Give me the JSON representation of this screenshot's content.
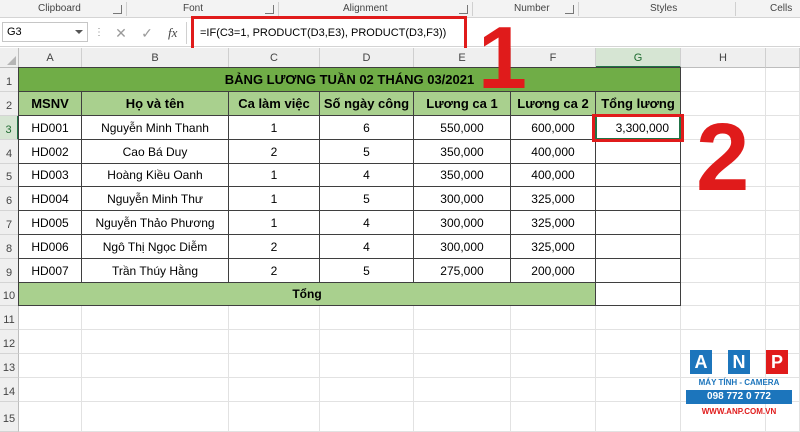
{
  "ribbon": {
    "groups": [
      "Clipboard",
      "Font",
      "Alignment",
      "Number",
      "Styles",
      "Cells"
    ]
  },
  "formula_bar": {
    "name_box": "G3",
    "formula": "=IF(C3=1, PRODUCT(D3,E3), PRODUCT(D3,F3))",
    "cancel_icon": "close-icon",
    "enter_icon": "check-icon",
    "fx_label": "fx"
  },
  "columns": [
    "A",
    "B",
    "C",
    "D",
    "E",
    "F",
    "G",
    "H"
  ],
  "rows": [
    "1",
    "2",
    "3",
    "4",
    "5",
    "6",
    "7",
    "8",
    "9",
    "10",
    "11",
    "12",
    "13",
    "14",
    "15"
  ],
  "table": {
    "title": "BẢNG LƯƠNG TUẦN 02 THÁNG 03/2021",
    "headers": [
      "MSNV",
      "Họ và tên",
      "Ca làm việc",
      "Số ngày công",
      "Lương ca 1",
      "Lương ca 2",
      "Tổng lương"
    ],
    "rows": [
      [
        "HD001",
        "Nguyễn Minh Thanh",
        "1",
        "6",
        "550,000",
        "600,000",
        "3,300,000"
      ],
      [
        "HD002",
        "Cao Bá Duy",
        "2",
        "5",
        "350,000",
        "400,000",
        ""
      ],
      [
        "HD003",
        "Hoàng Kiều Oanh",
        "1",
        "4",
        "350,000",
        "400,000",
        ""
      ],
      [
        "HD004",
        "Nguyễn Minh Thư",
        "1",
        "5",
        "300,000",
        "325,000",
        ""
      ],
      [
        "HD005",
        "Nguyễn Thảo Phương",
        "1",
        "4",
        "300,000",
        "325,000",
        ""
      ],
      [
        "HD006",
        "Ngô Thị Ngọc Diễm",
        "2",
        "4",
        "300,000",
        "325,000",
        ""
      ],
      [
        "HD007",
        "Trần Thúy Hằng",
        "2",
        "5",
        "275,000",
        "200,000",
        ""
      ]
    ],
    "total_label": "Tổng"
  },
  "annotations": {
    "step1": "1",
    "step2": "2"
  },
  "logo": {
    "letters": [
      "A",
      "N",
      "P"
    ],
    "tagline": "MÁY TÍNH - CAMERA",
    "phone": "098 772 0 772",
    "website": "WWW.ANP.COM.VN"
  },
  "colors": {
    "title_fill": "#70ad47",
    "header_fill": "#a9d08e",
    "callout_red": "#e01b1b",
    "selection_green": "#217346",
    "logo_blue": "#1c75bc",
    "logo_red": "#e01b1b"
  }
}
